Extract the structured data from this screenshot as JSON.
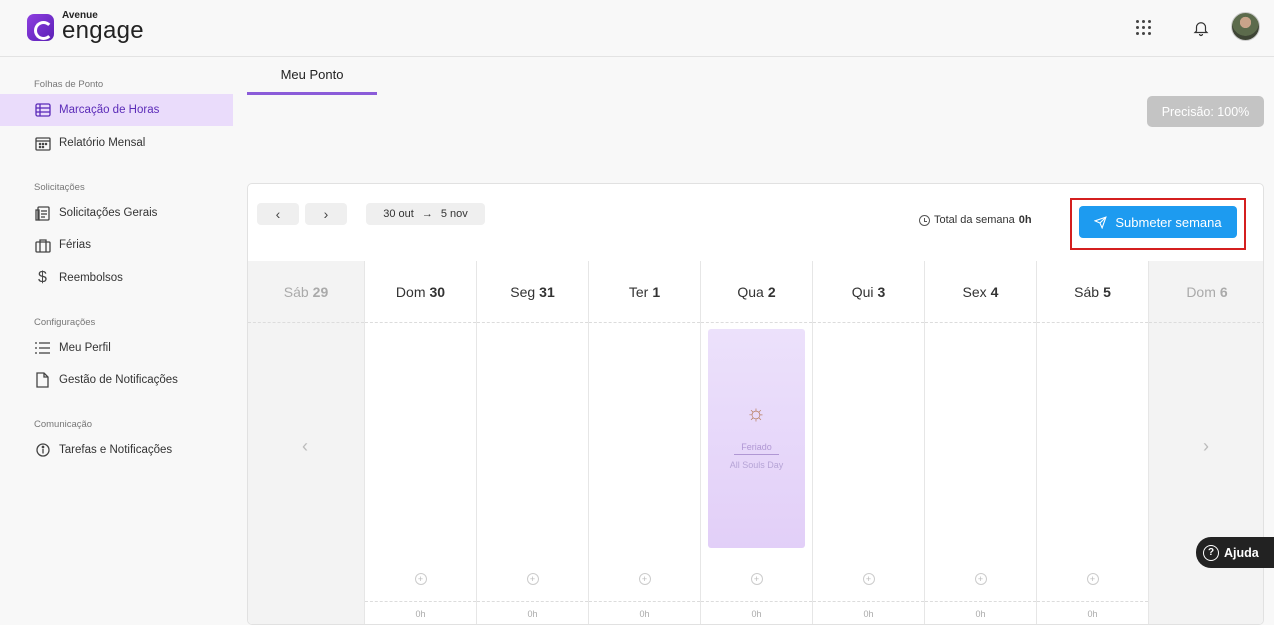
{
  "header": {
    "logo_small": "Avenue",
    "logo_big": "engage"
  },
  "sidebar": {
    "sections": [
      {
        "title": "Folhas de Ponto",
        "items": [
          {
            "label": "Marcação de Horas",
            "icon": "timesheet-icon",
            "active": true
          },
          {
            "label": "Relatório Mensal",
            "icon": "calendar-icon",
            "active": false
          }
        ]
      },
      {
        "title": "Solicitações",
        "items": [
          {
            "label": "Solicitações Gerais",
            "icon": "forms-icon",
            "active": false
          },
          {
            "label": "Férias",
            "icon": "suitcase-icon",
            "active": false
          },
          {
            "label": "Reembolsos",
            "icon": "dollar-icon",
            "active": false
          }
        ]
      },
      {
        "title": "Configurações",
        "items": [
          {
            "label": "Meu Perfil",
            "icon": "list-icon",
            "active": false
          },
          {
            "label": "Gestão de Notificações",
            "icon": "document-icon",
            "active": false
          }
        ]
      },
      {
        "title": "Comunicação",
        "items": [
          {
            "label": "Tarefas e Notificações",
            "icon": "info-icon",
            "active": false
          }
        ]
      }
    ]
  },
  "main": {
    "tab_label": "Meu Ponto",
    "precision_label": "Precisão: 100%",
    "week": {
      "range_start": "30 out",
      "range_end": "5 nov",
      "total_label": "Total da semana",
      "total_value": "0h",
      "submit_label": "Submeter semana"
    },
    "days": [
      {
        "name": "Sáb",
        "num": "29",
        "dim": true
      },
      {
        "name": "Dom",
        "num": "30",
        "dim": false,
        "hours": "0h"
      },
      {
        "name": "Seg",
        "num": "31",
        "dim": false,
        "hours": "0h"
      },
      {
        "name": "Ter",
        "num": "1",
        "dim": false,
        "hours": "0h"
      },
      {
        "name": "Qua",
        "num": "2",
        "dim": false,
        "hours": "0h",
        "holiday": {
          "title": "Feriado",
          "name": "All Souls Day"
        }
      },
      {
        "name": "Qui",
        "num": "3",
        "dim": false,
        "hours": "0h"
      },
      {
        "name": "Sex",
        "num": "4",
        "dim": false,
        "hours": "0h"
      },
      {
        "name": "Sáb",
        "num": "5",
        "dim": false,
        "hours": "0h"
      },
      {
        "name": "Dom",
        "num": "6",
        "dim": true
      }
    ]
  },
  "help_label": "Ajuda"
}
